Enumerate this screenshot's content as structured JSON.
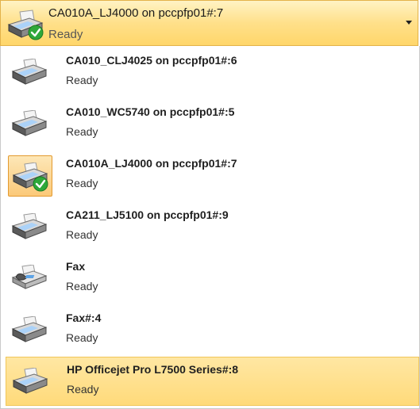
{
  "selected": {
    "name": "CA010A_LJ4000 on pccpfp01#:7",
    "status": "Ready",
    "icon": "printer-default-icon",
    "dropdown_icon": "chevron-down-icon"
  },
  "printers": [
    {
      "name": "CA010_CLJ4025 on pccpfp01#:6",
      "status": "Ready",
      "icon": "printer-icon"
    },
    {
      "name": "CA010_WC5740 on pccpfp01#:5",
      "status": "Ready",
      "icon": "printer-icon"
    },
    {
      "name": "CA010A_LJ4000 on pccpfp01#:7",
      "status": "Ready",
      "icon": "printer-default-icon"
    },
    {
      "name": "CA211_LJ5100 on pccpfp01#:9",
      "status": "Ready",
      "icon": "printer-icon"
    },
    {
      "name": "Fax",
      "status": "Ready",
      "icon": "fax-icon"
    },
    {
      "name": "Fax#:4",
      "status": "Ready",
      "icon": "printer-icon"
    },
    {
      "name": "HP Officejet Pro L7500 Series#:8",
      "status": "Ready",
      "icon": "printer-icon"
    }
  ],
  "colors": {
    "highlight": "#ffda7a",
    "checked_border": "#e39a2f",
    "check_green": "#2fa83a"
  }
}
